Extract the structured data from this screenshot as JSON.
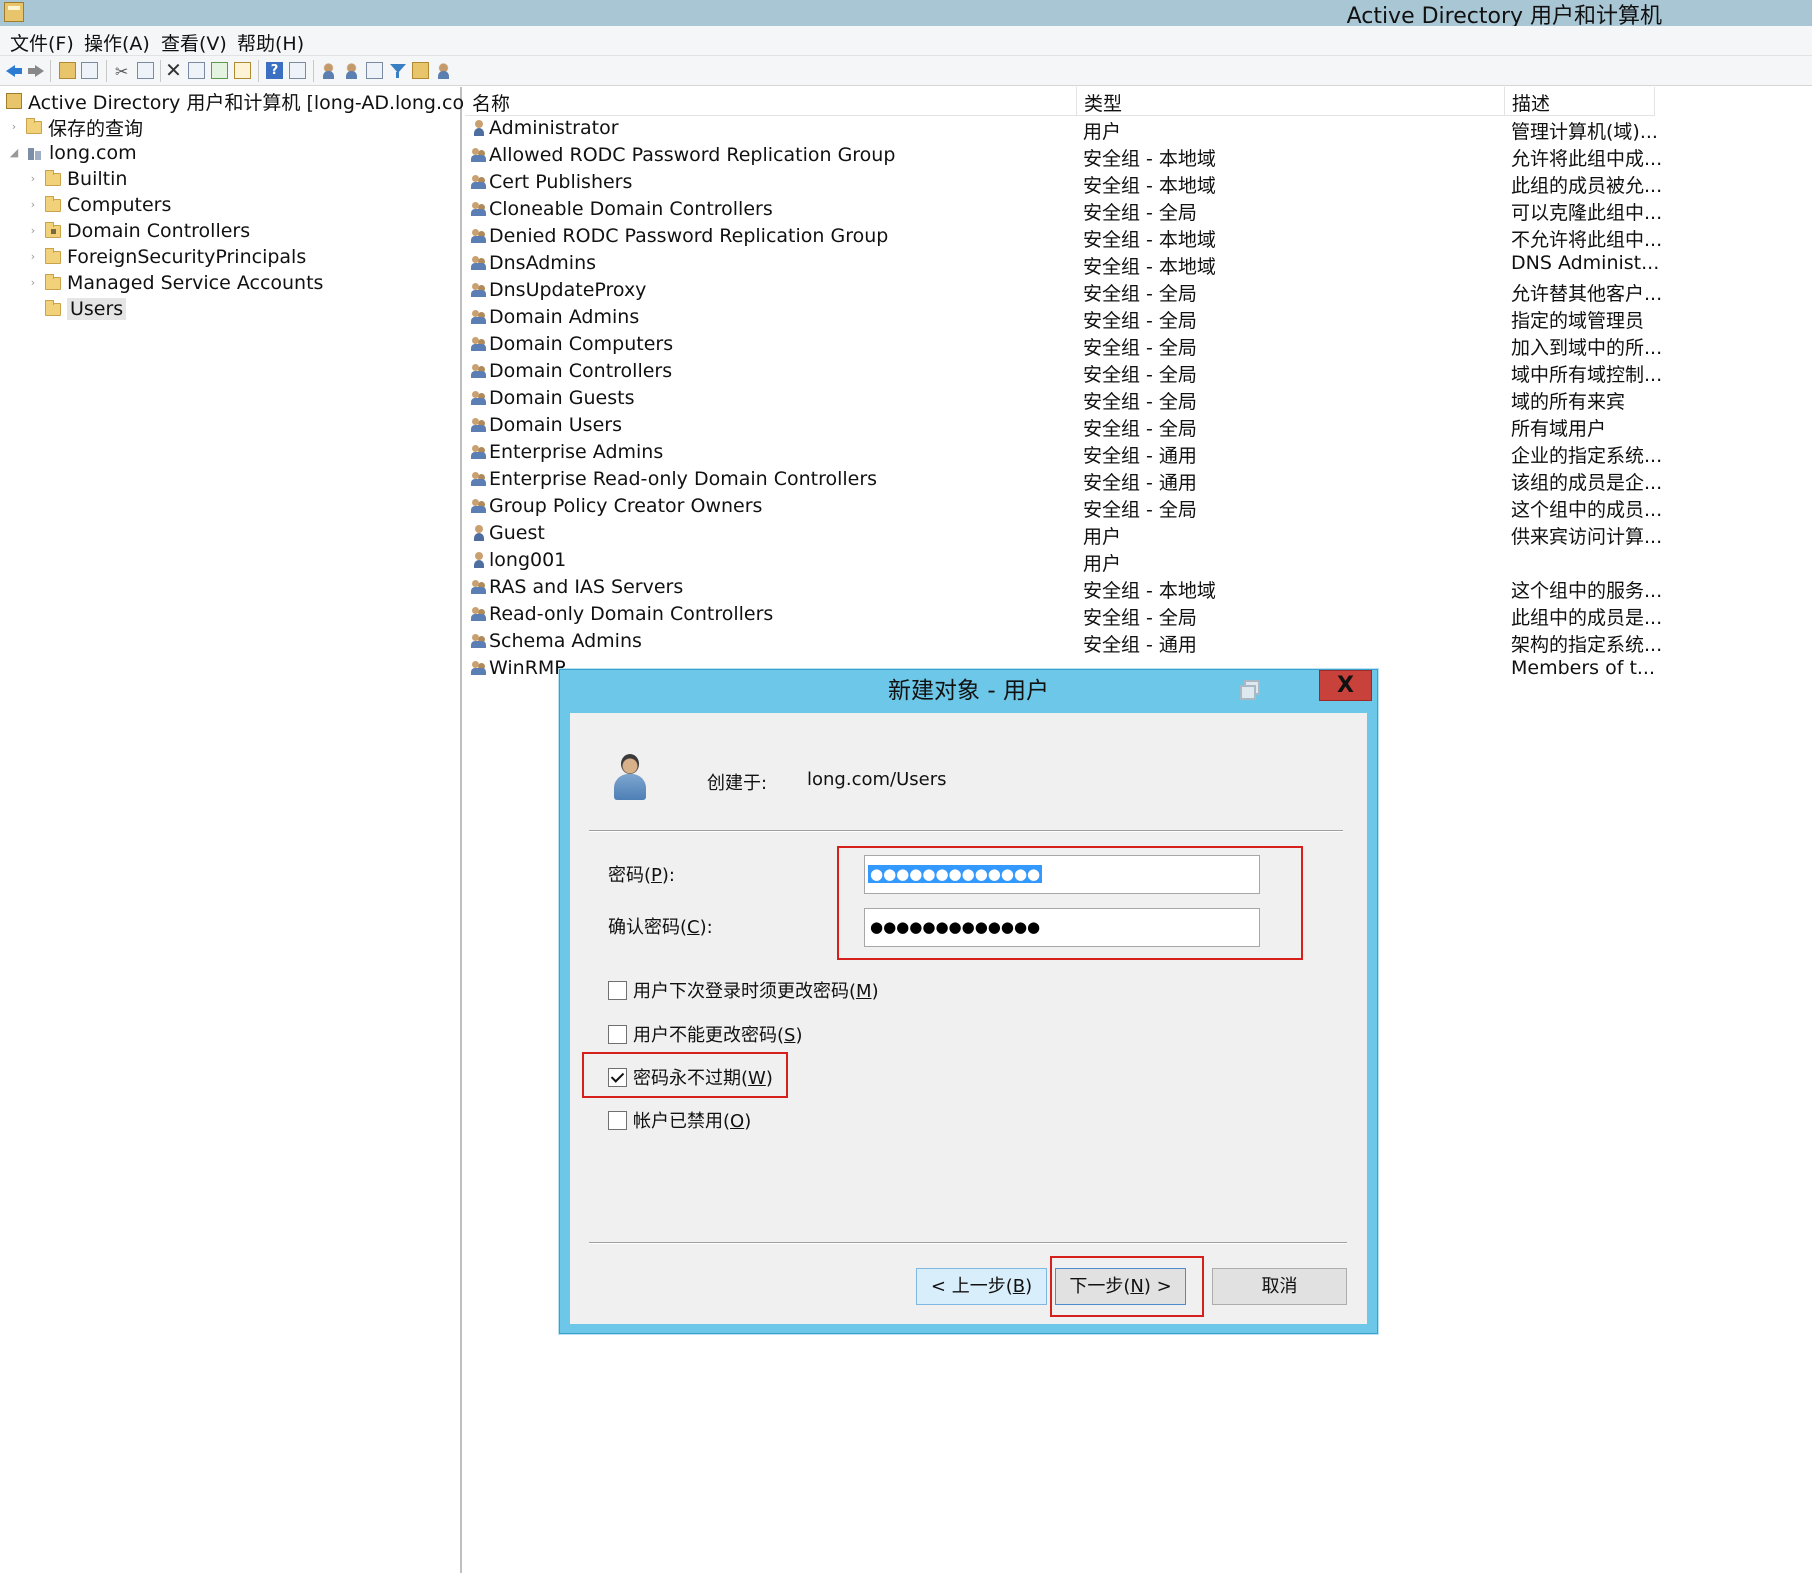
{
  "window": {
    "title": "Active Directory 用户和计算机"
  },
  "menu": [
    "文件(F)",
    "操作(A)",
    "查看(V)",
    "帮助(H)"
  ],
  "tree": {
    "root": "Active Directory 用户和计算机 [long-AD.long.com]",
    "saved_queries": "保存的查询",
    "domain": "long.com",
    "children": [
      "Builtin",
      "Computers",
      "Domain Controllers",
      "ForeignSecurityPrincipals",
      "Managed Service Accounts",
      "Users"
    ]
  },
  "list": {
    "columns": [
      "名称",
      "类型",
      "描述"
    ],
    "rows": [
      {
        "name": "Administrator",
        "type": "用户",
        "desc": "管理计算机(域)...",
        "icon": "user"
      },
      {
        "name": "Allowed RODC Password Replication Group",
        "type": "安全组 - 本地域",
        "desc": "允许将此组中成...",
        "icon": "group"
      },
      {
        "name": "Cert Publishers",
        "type": "安全组 - 本地域",
        "desc": "此组的成员被允...",
        "icon": "group"
      },
      {
        "name": "Cloneable Domain Controllers",
        "type": "安全组 - 全局",
        "desc": "可以克隆此组中...",
        "icon": "group"
      },
      {
        "name": "Denied RODC Password Replication Group",
        "type": "安全组 - 本地域",
        "desc": "不允许将此组中...",
        "icon": "group"
      },
      {
        "name": "DnsAdmins",
        "type": "安全组 - 本地域",
        "desc": "DNS Administ...",
        "icon": "group"
      },
      {
        "name": "DnsUpdateProxy",
        "type": "安全组 - 全局",
        "desc": "允许替其他客户...",
        "icon": "group"
      },
      {
        "name": "Domain Admins",
        "type": "安全组 - 全局",
        "desc": "指定的域管理员",
        "icon": "group"
      },
      {
        "name": "Domain Computers",
        "type": "安全组 - 全局",
        "desc": "加入到域中的所...",
        "icon": "group"
      },
      {
        "name": "Domain Controllers",
        "type": "安全组 - 全局",
        "desc": "域中所有域控制...",
        "icon": "group"
      },
      {
        "name": "Domain Guests",
        "type": "安全组 - 全局",
        "desc": "域的所有来宾",
        "icon": "group"
      },
      {
        "name": "Domain Users",
        "type": "安全组 - 全局",
        "desc": "所有域用户",
        "icon": "group"
      },
      {
        "name": "Enterprise Admins",
        "type": "安全组 - 通用",
        "desc": "企业的指定系统...",
        "icon": "group"
      },
      {
        "name": "Enterprise Read-only Domain Controllers",
        "type": "安全组 - 通用",
        "desc": "该组的成员是企...",
        "icon": "group"
      },
      {
        "name": "Group Policy Creator Owners",
        "type": "安全组 - 全局",
        "desc": "这个组中的成员...",
        "icon": "group"
      },
      {
        "name": "Guest",
        "type": "用户",
        "desc": "供来宾访问计算...",
        "icon": "user"
      },
      {
        "name": "long001",
        "type": "用户",
        "desc": "",
        "icon": "user"
      },
      {
        "name": "RAS and IAS Servers",
        "type": "安全组 - 本地域",
        "desc": "这个组中的服务...",
        "icon": "group"
      },
      {
        "name": "Read-only Domain Controllers",
        "type": "安全组 - 全局",
        "desc": "此组中的成员是...",
        "icon": "group"
      },
      {
        "name": "Schema Admins",
        "type": "安全组 - 通用",
        "desc": "架构的指定系统...",
        "icon": "group"
      },
      {
        "name": "WinRMR",
        "type": "",
        "desc": "Members of t...",
        "icon": "group"
      }
    ]
  },
  "dialog": {
    "title": "新建对象 - 用户",
    "close": "X",
    "created_in_label": "创建于:",
    "created_in_value": "long.com/Users",
    "password_label": "密码(",
    "password_key": "P",
    "password_label_end": "):",
    "confirm_label": "确认密码(",
    "confirm_key": "C",
    "confirm_label_end": "):",
    "password_dots": "●●●●●●●●●●●●●",
    "confirm_dots": "●●●●●●●●●●●●●",
    "options": [
      {
        "text": "用户下次登录时须更改密码(",
        "key": "M",
        "end": ")",
        "checked": false
      },
      {
        "text": "用户不能更改密码(",
        "key": "S",
        "end": ")",
        "checked": false
      },
      {
        "text": "密码永不过期(",
        "key": "W",
        "end": ")",
        "checked": true
      },
      {
        "text": "帐户已禁用(",
        "key": "O",
        "end": ")",
        "checked": false
      }
    ],
    "buttons": {
      "prev": "< 上一步(",
      "prev_key": "B",
      "prev_end": ")",
      "next": "下一步(",
      "next_key": "N",
      "next_end": ") >",
      "cancel": "取消"
    }
  },
  "colors": {
    "dialog_frame": "#6cc7e8",
    "highlight_box": "#d6201c",
    "selection": "#3399ff"
  }
}
